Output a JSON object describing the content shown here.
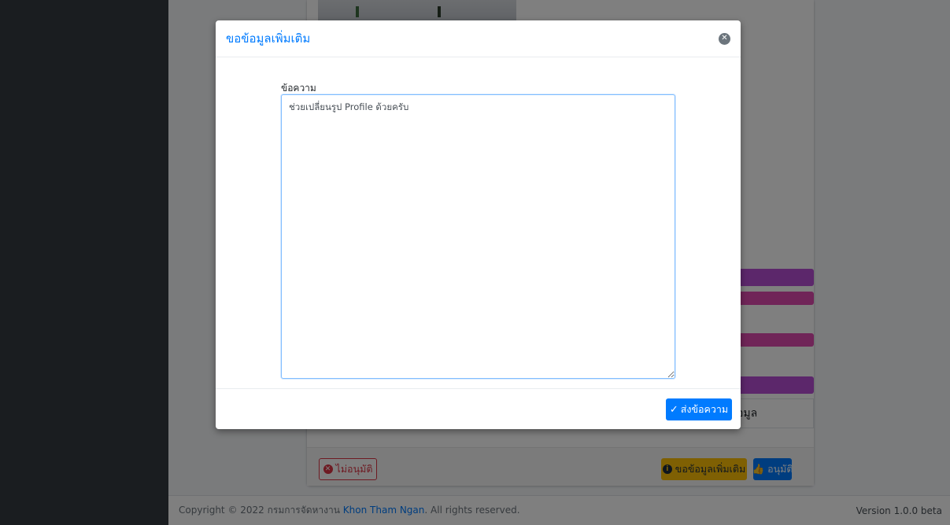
{
  "page": {
    "buttons": {
      "reject": "ไม่อนุมัติ",
      "request_info": "ขอข้อมูลเพิ่มเติม",
      "approve": "อนุมัติ"
    },
    "info_box_text": "อมูล",
    "icons": {
      "reject": "times-circle-icon",
      "request_info": "info-circle-icon",
      "approve": "thumbs-up-icon"
    }
  },
  "footer": {
    "copyright_prefix": "Copyright © 2022 กรมการจัดหางาน",
    "company": "Khon Tham Ngan",
    "copyright_suffix": ". All rights reserved.",
    "version": "Version 1.0.0 beta"
  },
  "modal": {
    "title": "ขอข้อมูลเพิ่มเติม",
    "message_label": "ข้อความ",
    "message_value": "ช่วยเปลี่ยนรูป Profile ด้วยครับ",
    "send_label": "ส่งข้อความ",
    "close_icon": "close-icon",
    "send_icon": "check-icon"
  },
  "colors": {
    "primary": "#007bff",
    "danger": "#dc3545",
    "warning": "#ffc107",
    "purple": "#b94fd6",
    "pink": "#e04bb1",
    "sidebar": "#343a40"
  }
}
